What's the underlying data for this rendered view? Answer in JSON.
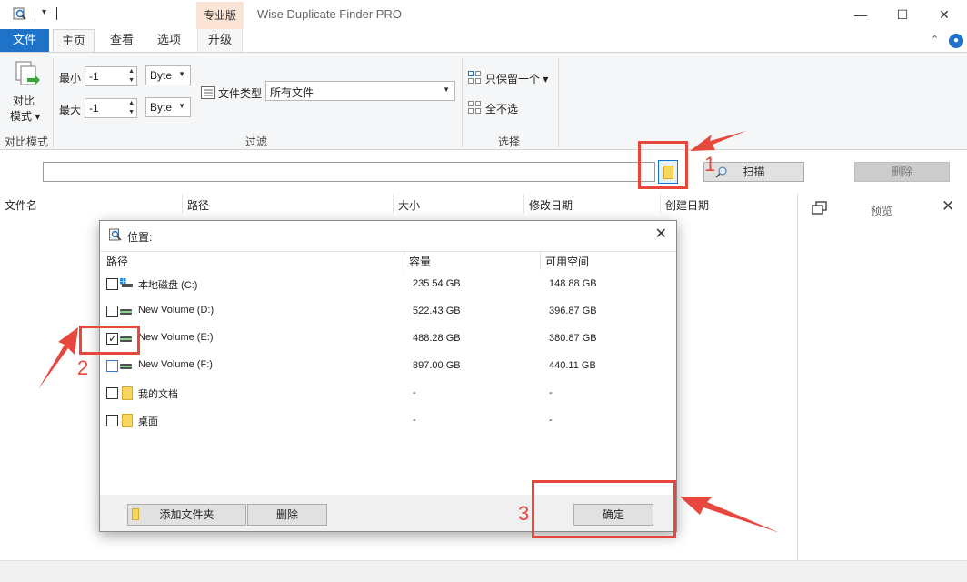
{
  "titlebar": {
    "pro_badge": "专业版",
    "app_title": "Wise Duplicate Finder PRO",
    "qa_drop": "▾"
  },
  "window_controls": {
    "minimize": "—",
    "maximize": "☐",
    "close": "✕"
  },
  "tabs": {
    "file": "文件",
    "home": "主页",
    "view": "查看",
    "options": "选项",
    "upgrade": "升级"
  },
  "ribbon": {
    "compare_mode": {
      "line1": "对比",
      "line2": "模式 ▾",
      "group": "对比模式"
    },
    "filter": {
      "min_label": "最小",
      "max_label": "最大",
      "min_value": "-1",
      "max_value": "-1",
      "min_unit": "Byte",
      "max_unit": "Byte",
      "filetype_label": "文件类型",
      "filetype_value": "所有文件",
      "group": "过滤"
    },
    "select": {
      "keep_one": "只保留一个 ▾",
      "select_none": "全不选",
      "group": "选择"
    }
  },
  "toolbar": {
    "path_value": "",
    "scan_label": "扫描",
    "delete_label": "删除"
  },
  "list_header": {
    "columns": [
      "文件名",
      "路径",
      "大小",
      "修改日期",
      "创建日期"
    ]
  },
  "preview": {
    "label": "预览"
  },
  "dialog": {
    "title": "位置:",
    "columns": [
      "路径",
      "容量",
      "可用空间"
    ],
    "rows": [
      {
        "name": "本地磁盘 (C:)",
        "capacity": "235.54 GB",
        "free": "148.88 GB",
        "checked": false,
        "icon": "windows-drive-icon"
      },
      {
        "name": "New Volume (D:)",
        "capacity": "522.43 GB",
        "free": "396.87 GB",
        "checked": false,
        "icon": "drive-icon"
      },
      {
        "name": "New Volume (E:)",
        "capacity": "488.28 GB",
        "free": "380.87 GB",
        "checked": true,
        "icon": "drive-icon"
      },
      {
        "name": "New Volume (F:)",
        "capacity": "897.00 GB",
        "free": "440.11 GB",
        "checked": false,
        "icon": "drive-icon"
      },
      {
        "name": "我的文档",
        "capacity": "-",
        "free": "-",
        "checked": false,
        "icon": "folder-icon"
      },
      {
        "name": "桌面",
        "capacity": "-",
        "free": "-",
        "checked": false,
        "icon": "folder-icon"
      }
    ],
    "add_folder": "添加文件夹",
    "remove": "删除",
    "ok": "确定"
  },
  "annotations": {
    "step1": "1",
    "step2": "2",
    "step3": "3"
  },
  "colors": {
    "accent": "#1e73c9",
    "annotation": "#e8473d",
    "pro_badge_bg": "#fbe4d5"
  }
}
